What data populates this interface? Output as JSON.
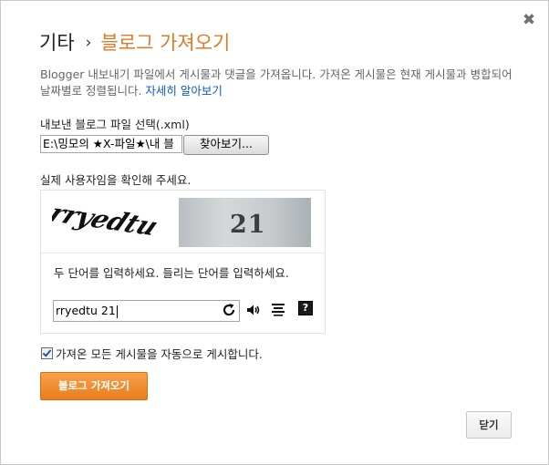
{
  "header": {
    "root": "기타",
    "separator": "›",
    "current": "블로그 가져오기"
  },
  "close_glyph": "✖",
  "description": {
    "text": "Blogger 내보내기 파일에서 게시물과 댓글을 가져옵니다. 가져온 게시물은 현재 게시물과 병합되어 날짜별로 정렬됩니다. ",
    "link": "자세히 알아보기"
  },
  "file": {
    "label": "내보낸 블로그 파일 선택(.xml)",
    "path": "E:\\밍모의 ★X-파일★\\내 블",
    "browse": "찾아보기..."
  },
  "captcha": {
    "label": "실제 사용자임을 확인해 주세요.",
    "word_image": "rryedtu",
    "number_image": "21",
    "instruction": "두 단어를 입력하세요. 들리는 단어를 입력하세요.",
    "input_value": "rryedtu 21",
    "help_glyph": "?"
  },
  "options": {
    "autopost_label": "가져온 모든 게시물을 자동으로 게시합니다.",
    "autopost_checked": true
  },
  "buttons": {
    "import": "블로그 가져오기",
    "close": "닫기"
  },
  "colors": {
    "accent": "#dd7a27",
    "import_button": "#f39a3f",
    "link": "#1155cc"
  }
}
